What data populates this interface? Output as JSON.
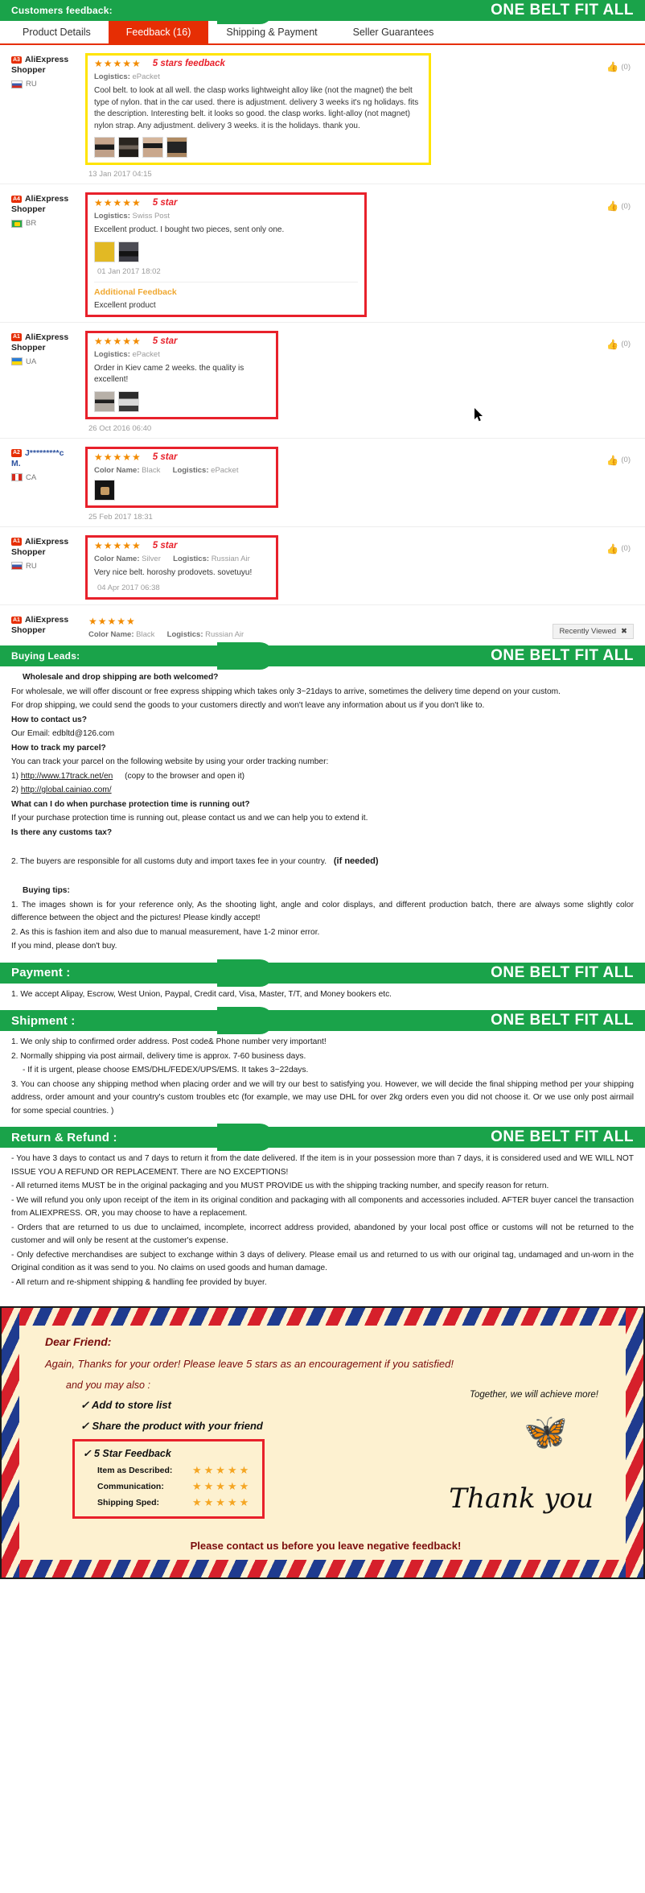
{
  "header": {
    "banner_left": "Customers feedback:",
    "banner_right": "ONE BELT FIT ALL"
  },
  "tabs": [
    {
      "label": "Product Details",
      "active": false
    },
    {
      "label": "Feedback (16)",
      "active": true
    },
    {
      "label": "Shipping & Payment",
      "active": false
    },
    {
      "label": "Seller Guarantees",
      "active": false
    }
  ],
  "feedback": {
    "stars_glyph": "★★★★★",
    "helpful_count": "(0)",
    "logistics_label": "Logistics:",
    "color_label": "Color Name:",
    "additional_title": "Additional Feedback",
    "reviews": [
      {
        "badge": "A3",
        "name_line1": "AliExpress",
        "name_line2": "Shopper",
        "country": "RU",
        "note": "5 stars feedback",
        "logistics": "ePacket",
        "color": "",
        "text": "Cool belt. to look at all well. the clasp works lightweight alloy like (not the magnet) the belt type of nylon. that in the car used. there is adjustment. delivery 3 weeks it's ng holidays. fits the description. Interesting belt. it looks so good. the clasp works. light-alloy (not magnet) nylon strap. Any adjustment. delivery 3 weeks. it is the holidays. thank you.",
        "date": "13 Jan 2017 04:15",
        "thumbs": 4
      },
      {
        "badge": "A4",
        "name_line1": "AliExpress",
        "name_line2": "Shopper",
        "country": "BR",
        "note": "5 star",
        "logistics": "Swiss Post",
        "color": "",
        "text": "Excellent product. I bought two pieces, sent only one.",
        "date": "01 Jan 2017 18:02",
        "thumbs": 2,
        "additional": "Excellent product"
      },
      {
        "badge": "A1",
        "name_line1": "AliExpress",
        "name_line2": "Shopper",
        "country": "UA",
        "note": "5 star",
        "logistics": "ePacket",
        "color": "",
        "text": "Order in Kiev came 2 weeks. the quality is excellent!",
        "date": "26 Oct 2016 06:40",
        "thumbs": 2
      },
      {
        "badge": "A2",
        "name_line1": "J*********c",
        "name_line2": "M.",
        "country": "CA",
        "note": "5 star",
        "logistics": "ePacket",
        "color": "Black",
        "text": "",
        "date": "25 Feb 2017 18:31",
        "thumbs": 1
      },
      {
        "badge": "A1",
        "name_line1": "AliExpress",
        "name_line2": "Shopper",
        "country": "RU",
        "note": "5 star",
        "logistics": "Russian Air",
        "color": "Silver",
        "text": "Very nice belt. horoshy prodovets. sovetuyu!",
        "date": "04 Apr 2017 06:38",
        "thumbs": 0
      },
      {
        "badge": "A1",
        "name_line1": "AliExpress",
        "name_line2": "Shopper",
        "country": "RU",
        "note": "",
        "logistics": "Russian Air",
        "color": "Black",
        "text": "",
        "date": "",
        "thumbs": 0
      }
    ],
    "recently_viewed": "Recently Viewed"
  },
  "buying_leads": {
    "banner_left": "Buying Leads:",
    "banner_right": "ONE BELT FIT ALL",
    "q1": "Wholesale and drop shipping are both welcomed?",
    "a1a": "For wholesale, we will offer discount or free express shipping which takes only 3~21days to arrive, sometimes the delivery time depend on your custom.",
    "a1b": "For drop shipping, we could send the goods to your customers directly and won't leave any information about us if you don't like to.",
    "q2": "How to contact us?",
    "a2": "Our Email: edbltd@126.com",
    "q3": "How to track my parcel?",
    "a3": "You can track your parcel on the following website by using your order tracking number:",
    "link1_prefix": "1)",
    "link1": "http://www.17track.net/en",
    "link1_note": "(copy to the browser and open it)",
    "link2_prefix": "2)",
    "link2": "http://global.cainiao.com/",
    "q4": "What can I do when purchase protection time is running out?",
    "a4": "If your purchase protection time is running out, please contact us and we can help you to extend it.",
    "q5": "Is there any customs tax?",
    "a5": "2. The buyers are responsible for all customs duty and import taxes fee in your country.",
    "a5_bold": "(if needed)",
    "tips_title": "Buying tips:",
    "tip1": "1. The images shown is for your reference only, As the shooting light, angle and color displays, and different production batch, there are always some slightly color difference between the object and the pictures! Please kindly accept!",
    "tip2": "2. As this is fashion item and also due to manual measurement, have 1-2 minor error.",
    "tip3": "If you mind, please don't buy."
  },
  "payment": {
    "banner_left": "Payment :",
    "banner_right": "ONE BELT FIT ALL",
    "line1": "1. We accept Alipay, Escrow, West Union, Paypal, Credit card, Visa, Master, T/T, and Money bookers etc."
  },
  "shipment": {
    "banner_left": "Shipment :",
    "banner_right": "ONE BELT FIT ALL",
    "line1": "1. We only ship to confirmed order address. Post code& Phone number very important!",
    "line2": "2. Normally shipping via post airmail, delivery time is approx. 7-60 business days.",
    "line3": "- If it is urgent, please choose EMS/DHL/FEDEX/UPS/EMS. It takes 3~22days.",
    "line4": "3. You can choose any shipping method when placing order and we will try our best to satisfying you. However, we will decide the final shipping method per your shipping address, order amount and your country's custom troubles etc (for example, we may use DHL for over 2kg orders even you did not choose it. Or we use only post airmail for some special countries. )"
  },
  "return_refund": {
    "banner_left": "Return & Refund :",
    "banner_right": "ONE BELT FIT ALL",
    "lines": [
      "- You have 3 days to contact us and 7 days to return it from the date delivered. If the item is in your possession more than 7 days, it is considered used and WE WILL NOT ISSUE YOU A REFUND OR REPLACEMENT. There are NO EXCEPTIONS!",
      "- All returned items MUST be in the original packaging and you MUST PROVIDE us with the shipping tracking number, and specify reason for return.",
      "- We will refund you only upon receipt of the item in its original condition and packaging with all components and accessories included. AFTER buyer cancel the transaction from ALIEXPRESS. OR, you may choose to have a replacement.",
      "- Orders that are returned to us due to unclaimed, incomplete, incorrect address provided, abandoned by your local post office or customs will not be returned to the customer and will only be resent at the customer's expense.",
      "- Only defective merchandises are subject to exchange within 3 days of delivery. Please email us and returned to us with our original tag, undamaged and un-worn in the Original condition as it was send to you. No claims on used goods and human damage.",
      "- All return and re-shipment shipping & handling fee provided by buyer."
    ]
  },
  "airmail": {
    "greeting": "Dear Friend:",
    "line2": "Again, Thanks for your order! Please leave 5 stars as an encouragement if you satisfied!",
    "line3": "and you may also :",
    "check1": "✓ Add to store list",
    "check2": "✓ Share the product with your friend",
    "together": "Together, we will achieve more!",
    "rating_title": "✓ 5 Star Feedback",
    "rating_rows": [
      {
        "label": "Item as Described:",
        "stars": "★★★★★"
      },
      {
        "label": "Communication:",
        "stars": "★★★★★"
      },
      {
        "label": "Shipping Sped:",
        "stars": "★★★★★"
      }
    ],
    "thank_you": "Thank you",
    "bottom": "Please contact us before you leave negative feedback!"
  },
  "colors": {
    "green": "#1aa34a",
    "red": "#e62e04",
    "highlight_red": "#e8212b",
    "highlight_yellow": "#ffe400",
    "star_orange": "#f28b00",
    "airmail_bg": "#fdf1d0"
  }
}
